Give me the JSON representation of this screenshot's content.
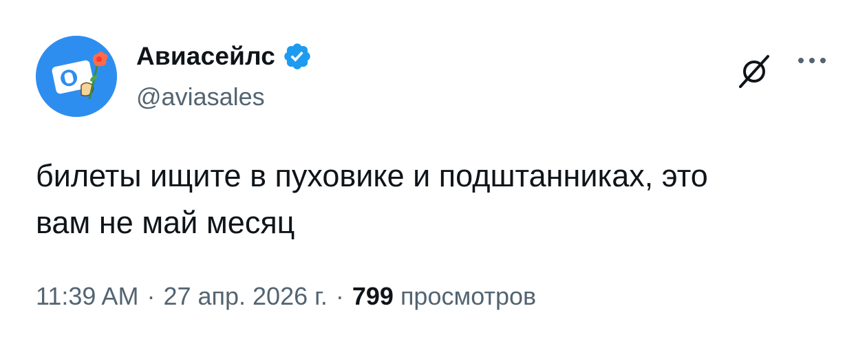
{
  "author": {
    "display_name": "Авиасейлс",
    "handle": "@aviasales",
    "verified": true,
    "avatar_icon": "aviasales-logo-with-flower",
    "verified_icon": "verified-badge-icon",
    "brand_color": "#2e8ef0",
    "verified_color": "#1d9bf0"
  },
  "header_actions": {
    "grok_icon": "grok-icon",
    "more_icon": "more-options-icon"
  },
  "tweet": {
    "line1": "билеты ищите в пуховике и подштанниках, это",
    "line2": "вам не май месяц"
  },
  "meta": {
    "time": "11:39 AM",
    "separator": "·",
    "date": "27 апр. 2026 г.",
    "views_count": "799",
    "views_label": "просмотров"
  },
  "colors": {
    "text_primary": "#0f1419",
    "text_secondary": "#536471",
    "background": "#ffffff"
  }
}
